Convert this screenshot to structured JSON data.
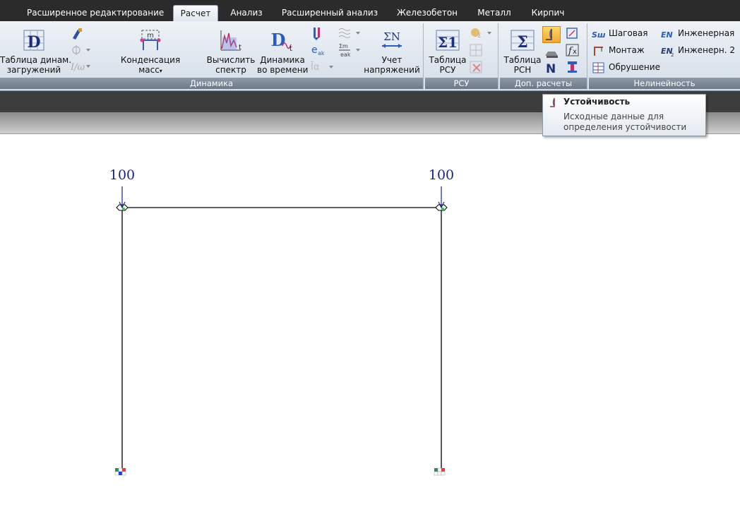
{
  "tabs": [
    {
      "label": "Расширенное редактирование"
    },
    {
      "label": "Расчет"
    },
    {
      "label": "Анализ"
    },
    {
      "label": "Расширенный анализ"
    },
    {
      "label": "Железобетон"
    },
    {
      "label": "Металл"
    },
    {
      "label": "Кирпич"
    }
  ],
  "ribbon": {
    "dynamics": {
      "label": "Динамика",
      "table_din": "Таблица динам.",
      "table_din_2": "загружений",
      "condense": "Конденсация",
      "condense_2": "масс",
      "spectrum": "Вычислить",
      "spectrum_2": "спектр",
      "time": "Динамика",
      "time_2": "во времени",
      "stress": "Учет",
      "stress_2": "напряжений"
    },
    "rsu": {
      "label": "РСУ",
      "table": "Таблица",
      "table_2": "РСУ"
    },
    "extra": {
      "label": "Доп. расчеты",
      "table": "Таблица",
      "table_2": "РСН"
    },
    "nonlinear": {
      "label": "Нелинейность",
      "step": "Шаговая",
      "mount": "Монтаж",
      "collapse": "Обрушение",
      "eng": "Инженерная",
      "eng2": "Инженерн. 2"
    }
  },
  "tooltip": {
    "title": "Устойчивость",
    "desc": "Исходные данные для определения устойчивости"
  },
  "canvas": {
    "load_left": "100",
    "load_right": "100"
  },
  "colors": {
    "frame": "#000000",
    "load": "#1a237e",
    "ribbon_label_bg": "#7a8696"
  }
}
